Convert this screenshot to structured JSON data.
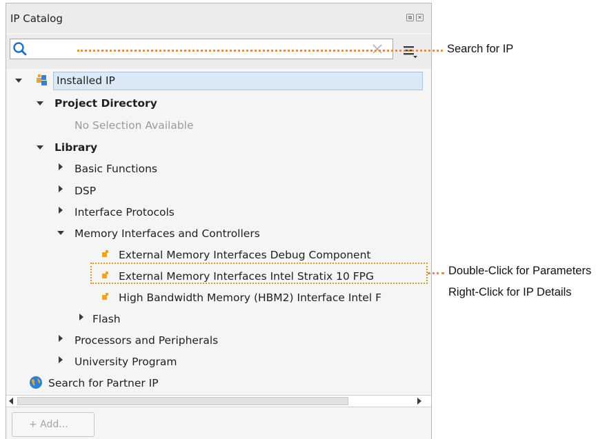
{
  "window": {
    "title": "IP Catalog",
    "float_button_glyph": "⧉",
    "close_button_glyph": "✕"
  },
  "search": {
    "value": "",
    "placeholder": ""
  },
  "tree": {
    "installed_ip": "Installed IP",
    "project_directory": "Project Directory",
    "no_selection": "No Selection Available",
    "library": "Library",
    "basic_functions": "Basic Functions",
    "dsp": "DSP",
    "interface_protocols": "Interface Protocols",
    "memory_interfaces": "Memory Interfaces and Controllers",
    "emif_debug": "External Memory Interfaces Debug Component",
    "emif_stratix": "External Memory Interfaces Intel Stratix 10 FPG",
    "hbm2": "High Bandwidth Memory (HBM2) Interface Intel F",
    "flash": "Flash",
    "processors": "Processors and Peripherals",
    "university": "University Program",
    "partner_ip": "Search for Partner IP"
  },
  "buttons": {
    "add_label": "+ Add..."
  },
  "callouts": {
    "search_for_ip": "Search for IP",
    "double_click": "Double-Click for Parameters",
    "right_click": "Right-Click for IP Details"
  },
  "colors": {
    "accent_callout": "#e8912a",
    "selection_bg": "#dbe8f5",
    "search_icon": "#1f6fbf",
    "ip_icon": "#f2a122"
  },
  "icons": {
    "search": "search-icon",
    "clear": "clear-icon",
    "menu": "menu-icon",
    "installed_ip": "installed-ip-icon",
    "ip_component": "ip-component-icon",
    "globe": "globe-icon"
  }
}
